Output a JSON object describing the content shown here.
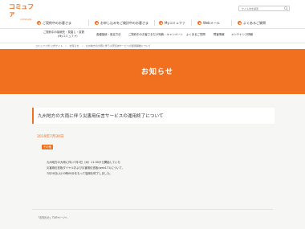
{
  "header": {
    "logo_main": "コミュファ",
    "logo_sub": "commufa",
    "search_placeholder": "サイト内を検索"
  },
  "nav_primary": [
    {
      "label": "ご契約中のお客さま"
    },
    {
      "label": "お申し込みをご検討中のお客さま"
    },
    {
      "label": "Myコミュファ"
    },
    {
      "label": "Webメール"
    },
    {
      "label": "よくあるご質問"
    }
  ],
  "nav_secondary": [
    {
      "line1": "ご契約中の接続先・見直し・変更",
      "line2": "(Myコミュファ)"
    },
    {
      "line1": "各種接続・設定方法"
    },
    {
      "line1": "ご契約中のお客さまだけ特典・キャンペーン"
    },
    {
      "line1": "よくあるご質問"
    },
    {
      "line1": "障害情報"
    },
    {
      "line1": "メンテナンス情報"
    }
  ],
  "breadcrumb": {
    "items": [
      "コミュファ光 公式サイト",
      "お知らせ",
      "九州地方の大雨に伴う災害伝言サービスの運用開始について"
    ],
    "separator": ">"
  },
  "banner": {
    "title": "お知らせ"
  },
  "article": {
    "title": "九州地方の大雨に伴う災害用伝言サービスの運用終了について",
    "date": "2019年7月30日",
    "tag": "その他",
    "body_lines": [
      "九州地方の大雨に伴い7月3日（木）11:30から開始していた",
      "災害用伝言板ダイヤルおよび災害用伝言板(web171)について、",
      "7月30日(火)10時00分をもって運用を終了しました。"
    ]
  },
  "footer": {
    "link": "「お知らせ」TOPページへ"
  },
  "colors": {
    "accent": "#f07020",
    "content_bg": "#f6f6f4"
  }
}
